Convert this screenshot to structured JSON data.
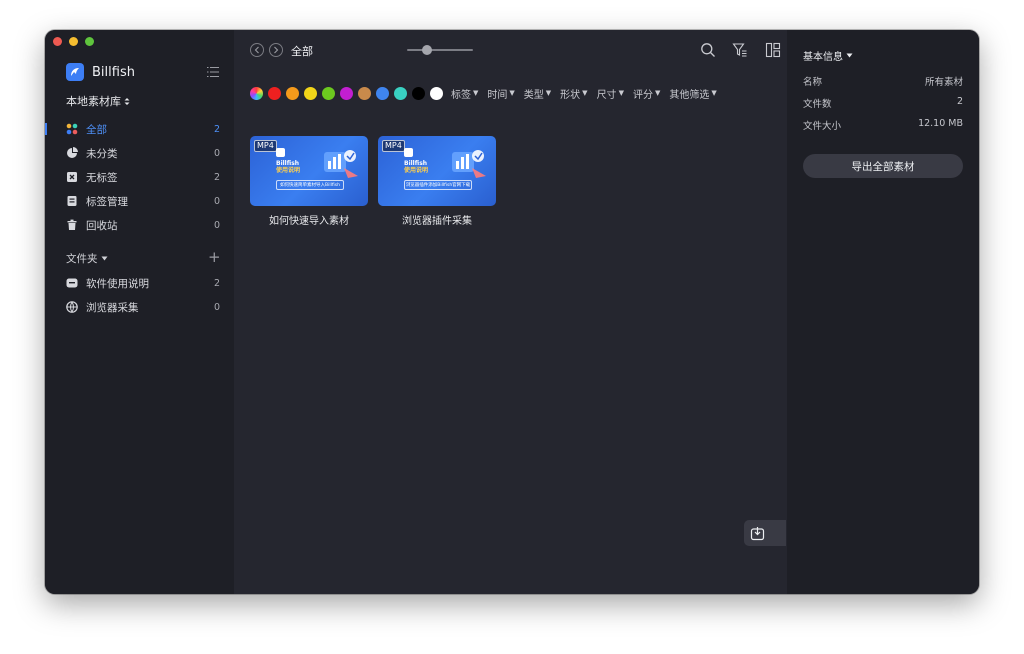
{
  "app": {
    "name": "Billfish",
    "library": "本地素材库"
  },
  "sidebar": {
    "items": [
      {
        "label": "全部",
        "count": "2"
      },
      {
        "label": "未分类",
        "count": "0"
      },
      {
        "label": "无标签",
        "count": "2"
      },
      {
        "label": "标签管理",
        "count": "0"
      },
      {
        "label": "回收站",
        "count": "0"
      }
    ],
    "folders_header": "文件夹",
    "folders": [
      {
        "label": "软件使用说明",
        "count": "2"
      },
      {
        "label": "浏览器采集",
        "count": "0"
      }
    ]
  },
  "toolbar": {
    "breadcrumb": "全部"
  },
  "filters": {
    "colors": [
      "#ee2020",
      "#f59a1b",
      "#f2d519",
      "#6cc91f",
      "#c31ed1",
      "#c98a4b",
      "#3f85f0",
      "#39d1c2",
      "#000000",
      "#ffffff"
    ],
    "labels": [
      "标签",
      "时间",
      "类型",
      "形状",
      "尺寸",
      "评分",
      "其他筛选"
    ]
  },
  "assets": [
    {
      "badge": "MP4",
      "thumb_line1": "Billfish",
      "thumb_line2": "使用说明",
      "thumb_caption": "如何快速简单素材导入Billfish",
      "label": "如何快速导入素材"
    },
    {
      "badge": "MP4",
      "thumb_line1": "Billfish",
      "thumb_line2": "使用说明",
      "thumb_caption": "浏览器插件添加Billfish官网下载",
      "label": "浏览器插件采集"
    }
  ],
  "inspector": {
    "title": "基本信息",
    "rows": [
      {
        "key": "名称",
        "value": "所有素材"
      },
      {
        "key": "文件数",
        "value": "2"
      },
      {
        "key": "文件大小",
        "value": "12.10 MB"
      }
    ],
    "export_label": "导出全部素材"
  },
  "colors": {
    "accent": "#3d7ef5",
    "sidebar_bg": "#1e1f26",
    "main_bg": "#25262f"
  },
  "icons": [
    "dashboard-icon",
    "pie-icon",
    "untagged-icon",
    "tag-manage-icon",
    "trash-icon",
    "folder-icon",
    "globe-icon",
    "search-icon",
    "filter-icon",
    "layout-icon",
    "theme-shirt-icon",
    "import-icon"
  ]
}
